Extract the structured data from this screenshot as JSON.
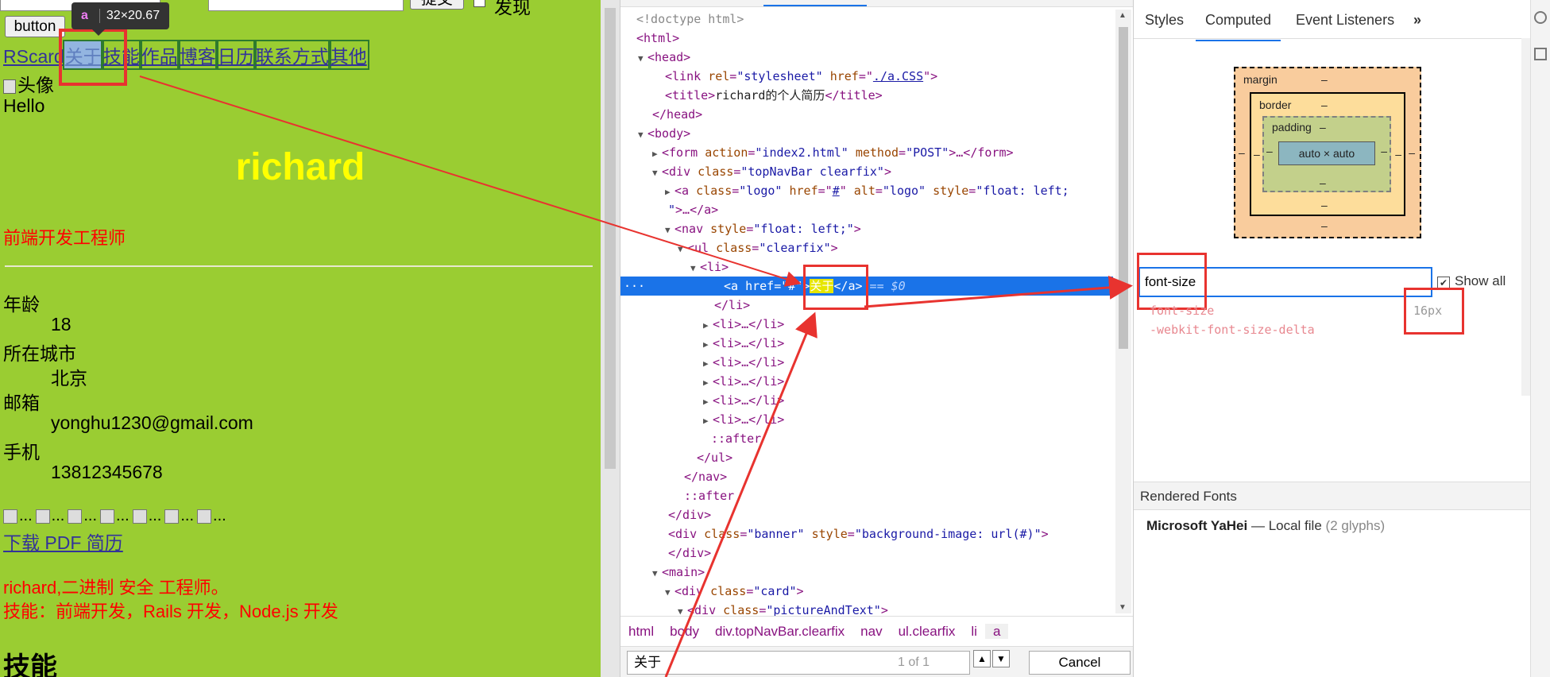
{
  "preview": {
    "top_button": "button",
    "submit_label": "提交",
    "checkbox_label": "发现",
    "tooltip": {
      "tag": "a",
      "size": "32×20.67"
    },
    "logo": "RScard",
    "nav_items": [
      "关于",
      "技能",
      "作品",
      "博客",
      "日历",
      "联系方式",
      "其他"
    ],
    "avatar_alt": "头像",
    "hello": "Hello",
    "name": "richard",
    "job": "前端开发工程师",
    "info": [
      {
        "label": "年龄",
        "value": "18"
      },
      {
        "label": "所在城市",
        "value": "北京"
      },
      {
        "label": "邮箱",
        "value": "yonghu1230@gmail.com"
      },
      {
        "label": "手机",
        "value": "13812345678"
      }
    ],
    "broken_image_text": "...",
    "pdf_link": "下载 PDF 简历",
    "intro_line1": "richard,二进制 安全 工程师。",
    "intro_line2": "技能：前端开发，Rails 开发，Node.js 开发",
    "skills_heading": "技能"
  },
  "elements": {
    "lines": {
      "doctype": "<!doctype html>",
      "html_open": "<html>",
      "head_open": "<head>",
      "link_tag": "link",
      "link_rel_attr": "rel",
      "link_rel_val": "\"stylesheet\"",
      "link_href_attr": "href",
      "link_href_val": "./a.CSS",
      "title_text": "richard的个人简历",
      "form_action": "\"index2.html\"",
      "form_method": "\"POST\"",
      "div_class": "\"topNavBar clearfix\"",
      "logo_class": "\"logo\"",
      "logo_href": "#",
      "logo_alt": "\"logo\"",
      "logo_style": "\"float: left;",
      "nav_style": "\"float: left;\"",
      "ul_class": "\"clearfix\"",
      "sel_href": "\"#\"",
      "sel_text": "关于",
      "sel_eq": "== $0",
      "banner_class": "\"banner\"",
      "banner_style": "\"background-image: url(#)\"",
      "card_class": "\"card\"",
      "pt_class": "\"pictureAndText\""
    },
    "breadcrumbs": [
      "html",
      "body",
      "div.topNavBar.clearfix",
      "nav",
      "ul.clearfix",
      "li",
      "a"
    ],
    "find_query": "关于",
    "find_count": "1 of 1",
    "cancel_label": "Cancel"
  },
  "sidebar": {
    "tabs": [
      "Styles",
      "Computed",
      "Event Listeners",
      "»"
    ],
    "box_model": {
      "margin": "margin",
      "border": "border",
      "padding": "padding",
      "content": "auto × auto",
      "dash": "–"
    },
    "filter_value": "font-size",
    "show_all_label": "Show all",
    "properties": [
      {
        "name": "font-size",
        "value": "16px"
      },
      {
        "name": "-webkit-font-size-delta",
        "value": ""
      }
    ],
    "rendered_fonts_heading": "Rendered Fonts",
    "font_name": "Microsoft YaHei",
    "font_source": "— Local file",
    "font_glyphs": "(2 glyphs)"
  },
  "colors": {
    "page_bg": "#9acd32",
    "highlight_red": "#e8332f",
    "name_yellow": "#ffff00",
    "selection_blue": "#1a73e8"
  }
}
